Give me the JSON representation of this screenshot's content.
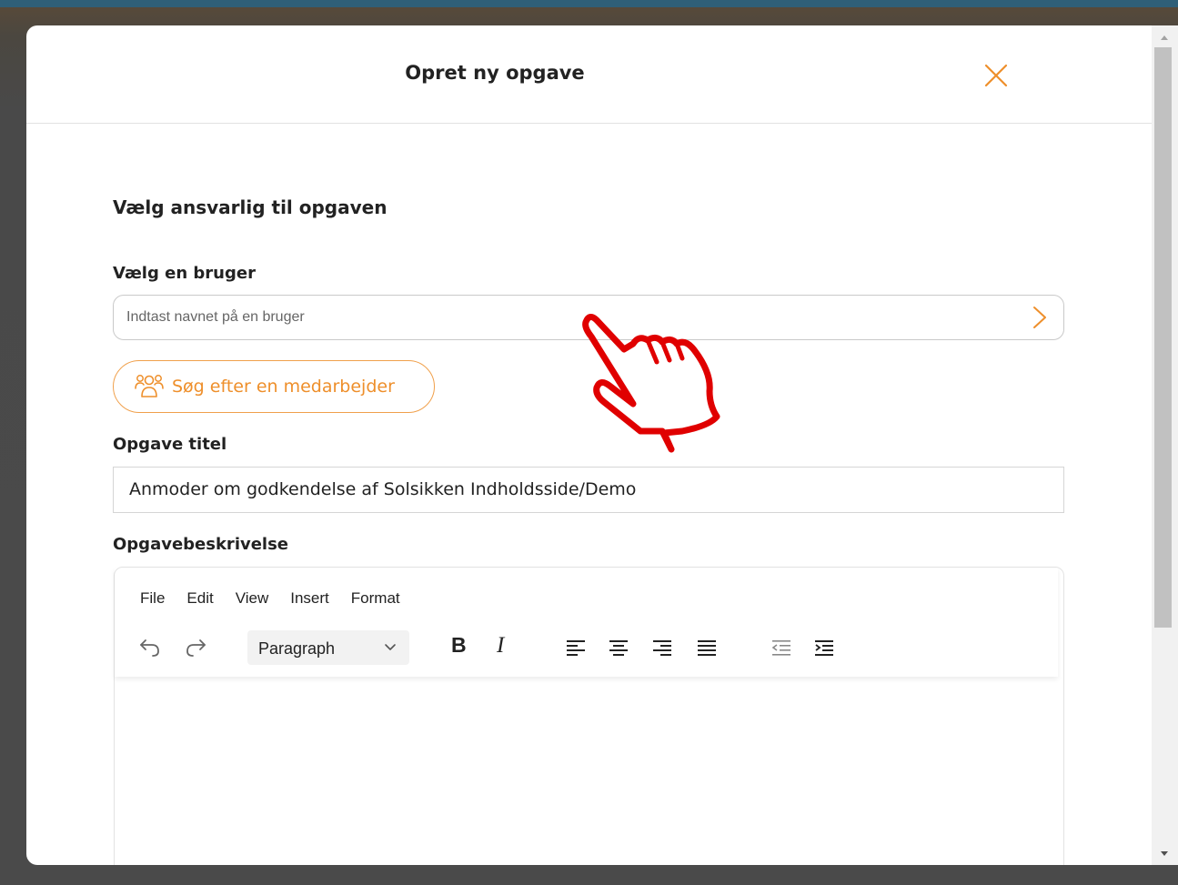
{
  "modal": {
    "title": "Opret ny opgave",
    "section_heading": "Vælg ansvarlig til opgaven",
    "user_field": {
      "label": "Vælg en bruger",
      "placeholder": "Indtast navnet på en bruger",
      "value": ""
    },
    "search_employee_button": "Søg efter en medarbejder",
    "task_title": {
      "label": "Opgave titel",
      "value": "Anmoder om godkendelse af Solsikken Indholdsside/Demo"
    },
    "description": {
      "label": "Opgavebeskrivelse",
      "menu": [
        "File",
        "Edit",
        "View",
        "Insert",
        "Format"
      ],
      "block_format": "Paragraph",
      "content": ""
    }
  },
  "colors": {
    "accent": "#ee8f2b",
    "topbar": "#2f5f78",
    "hand_cursor": "#e00000"
  },
  "icons": {
    "close": "close-icon",
    "chevron": "chevron-right-icon",
    "users": "users-icon",
    "undo": "undo-icon",
    "redo": "redo-icon",
    "bold": "bold-icon",
    "italic": "italic-icon",
    "align_left": "align-left-icon",
    "align_center": "align-center-icon",
    "align_right": "align-right-icon",
    "align_justify": "align-justify-icon",
    "outdent": "outdent-icon",
    "indent": "indent-icon",
    "pointer": "hand-pointer-icon"
  }
}
